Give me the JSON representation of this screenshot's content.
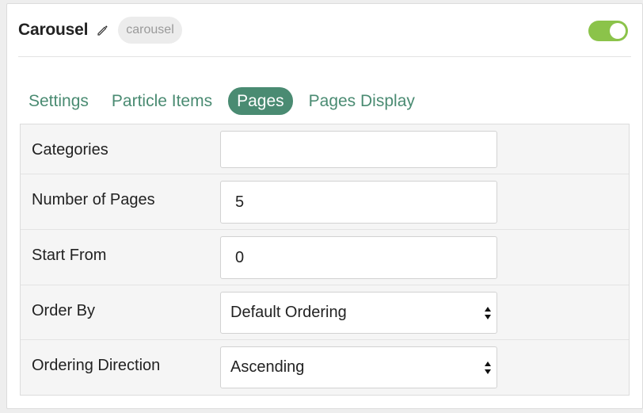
{
  "header": {
    "title": "Carousel",
    "badge": "carousel",
    "enabled": true
  },
  "tabs": [
    {
      "label": "Settings",
      "active": false
    },
    {
      "label": "Particle Items",
      "active": false
    },
    {
      "label": "Pages",
      "active": true
    },
    {
      "label": "Pages Display",
      "active": false
    }
  ],
  "fields": {
    "categories": {
      "label": "Categories",
      "value": ""
    },
    "number_of_pages": {
      "label": "Number of Pages",
      "value": "5"
    },
    "start_from": {
      "label": "Start From",
      "value": "0"
    },
    "order_by": {
      "label": "Order By",
      "value": "Default Ordering"
    },
    "ordering_direction": {
      "label": "Ordering Direction",
      "value": "Ascending"
    }
  },
  "colors": {
    "accent": "#4a8b72",
    "toggle_on": "#8bc34a"
  },
  "icons": {
    "edit": "pencil-icon",
    "select": "updown-arrows-icon"
  }
}
